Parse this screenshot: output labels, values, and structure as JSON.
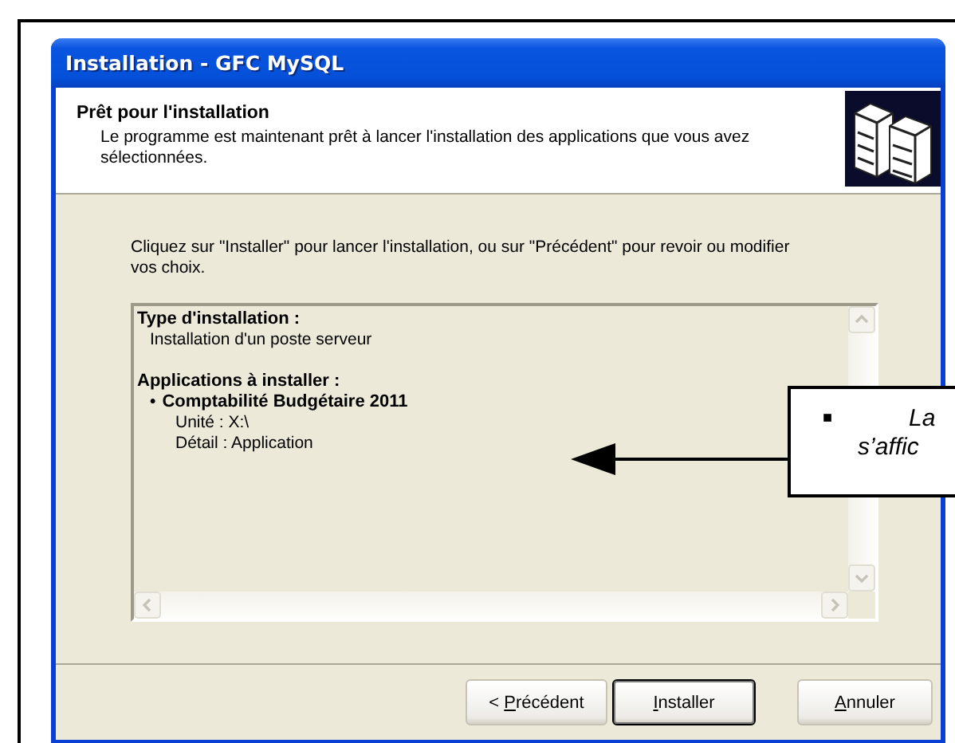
{
  "window": {
    "title": "Installation - GFC MySQL"
  },
  "header": {
    "title": "Prêt pour l'installation",
    "description": "Le programme est maintenant prêt à lancer l'installation des applications que vous avez sélectionnées."
  },
  "instructions": "Cliquez sur \"Installer\" pour lancer l'installation, ou sur \"Précédent\" pour revoir ou modifier vos choix.",
  "summary": {
    "sections": [
      {
        "heading": "Type d'installation :",
        "lines": [
          "Installation d'un poste serveur"
        ]
      },
      {
        "heading": "Applications à installer :",
        "items": [
          {
            "bullet": "•",
            "name": "Comptabilité Budgétaire 2011",
            "details": [
              "Unité : X:\\",
              "Détail : Application"
            ]
          }
        ]
      }
    ]
  },
  "buttons": [
    {
      "prefix": "< ",
      "access_key": "P",
      "rest": "récédent",
      "default": false
    },
    {
      "access_key": "I",
      "rest": "nstaller",
      "default": true
    },
    {
      "access_key": "A",
      "rest": "nnuler",
      "default": false
    }
  ],
  "callout": {
    "bullet": "■",
    "lines": [
      "La",
      "s’affic"
    ]
  }
}
